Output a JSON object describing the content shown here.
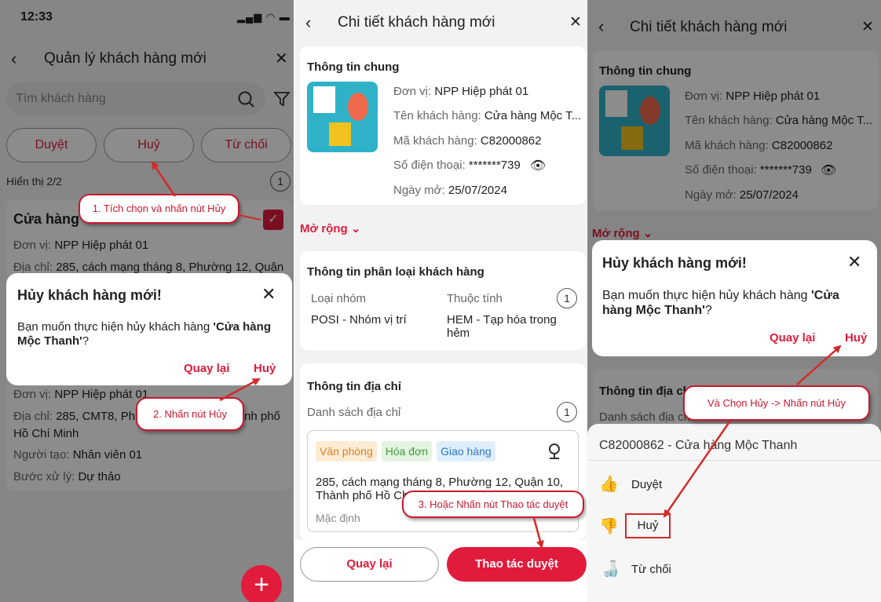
{
  "p1": {
    "status_time": "12:33",
    "title": "Quản lý khách hàng mới",
    "search_placeholder": "Tìm khách hàng",
    "tabs": [
      "Duyệt",
      "Huỷ",
      "Từ chối"
    ],
    "display_count": "Hiển thị 2/2",
    "count_badge": "1",
    "card1": {
      "name": "Cửa hàng",
      "unit_label": "Đơn vị:",
      "unit_value": "NPP Hiệp phát 01",
      "addr_label": "Địa chỉ:",
      "addr_value": "285, cách mạng tháng 8, Phường 12, Quận"
    },
    "card2": {
      "unit_label": "Đơn vị:",
      "unit_value": "NPP Hiệp phát 01",
      "addr_label": "Địa chỉ:",
      "addr_value": "285, CMT8, Phư",
      "addr_value_end": "nh phố",
      "addr_line2": "Hồ Chí Minh",
      "creator_label": "Người tạo:",
      "creator_value": "Nhân viên 01",
      "step_label": "Bước xử lý:",
      "step_value": "Dự thảo"
    },
    "dialog": {
      "title": "Hủy khách hàng mới!",
      "msg_prefix": "Bạn muốn thực hiện hủy khách hàng ",
      "msg_name": "'Cửa hàng Mộc Thanh'",
      "msg_suffix": "?",
      "back": "Quay lại",
      "cancel": "Huỷ"
    },
    "fab": "+",
    "callout1": "1.  Tích chọn và nhấn nút Hủy",
    "callout2": "2. Nhấn nút Hủy"
  },
  "p2": {
    "title": "Chi tiết khách hàng mới",
    "general_title": "Thông tin chung",
    "unit_label": "Đơn vị:",
    "unit_value": "NPP Hiệp phát 01",
    "name_label": "Tên khách hàng:",
    "name_value": "Cửa hàng Mộc T...",
    "code_label": "Mã khách hàng:",
    "code_value": "C82000862",
    "phone_label": "Số điện thoại:",
    "phone_value": "*******739",
    "date_label": "Ngày mở:",
    "date_value": "25/07/2024",
    "expand": "Mở rộng",
    "class_title": "Thông tin phân loại khách hàng",
    "group_label": "Loại nhóm",
    "group_value": "POSI - Nhóm vị trí",
    "attr_label": "Thuộc tính",
    "attr_value": "HEM - Tạp hóa trong hẻm",
    "class_badge": "1",
    "addr_title": "Thông tin địa chỉ",
    "addr_list": "Danh sách địa chỉ",
    "addr_badge": "1",
    "tags": [
      "Văn phòng",
      "Hóa đơn",
      "Giao hàng"
    ],
    "addr_line1": "285, cách mạng tháng 8, Phường 12, Quận 10,",
    "addr_line2": "Thành phố Hồ Ch",
    "addr_default": "Mặc định",
    "btn_back": "Quay lại",
    "btn_approve": "Thao tác duyệt",
    "callout3": "3. Hoặc Nhấn nút Thao tác duyệt"
  },
  "p3": {
    "title": "Chi tiết khách hàng mới",
    "general_title": "Thông tin chung",
    "unit_label": "Đơn vị:",
    "unit_value": "NPP Hiệp phát 01",
    "name_label": "Tên khách hàng:",
    "name_value": "Cửa hàng Mộc T...",
    "code_label": "Mã khách hàng:",
    "code_value": "C82000862",
    "phone_label": "Số điện thoại:",
    "phone_value": "*******739",
    "date_label": "Ngày mở:",
    "date_value": "25/07/2024",
    "expand": "Mở rộng",
    "addr_title": "Thông tin địa chỉ",
    "addr_list": "Danh sách địa chỉ",
    "dialog": {
      "title": "Hủy khách hàng mới!",
      "msg_prefix": "Bạn muốn thực hiện hủy khách hàng ",
      "msg_name": "'Cửa hàng Mộc Thanh'",
      "msg_suffix": "?",
      "back": "Quay lại",
      "cancel": "Huỷ"
    },
    "sheet_header": "C82000862 - Cửa hàng Mộc Thanh",
    "sheet_items": [
      "Duyệt",
      "Huỷ",
      "Từ chối"
    ],
    "callout4": "Và Chọn Hủy -> Nhấn nút Hủy"
  },
  "colors": {
    "accent": "#e11b3c",
    "callout_border": "#c8192f"
  }
}
